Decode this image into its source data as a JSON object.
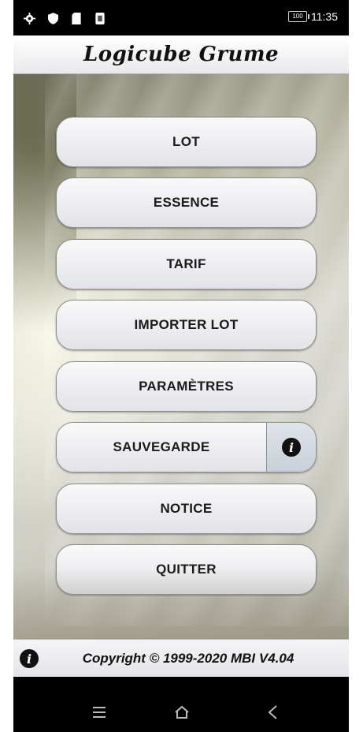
{
  "status_bar": {
    "icons": [
      "gear-icon",
      "shield-icon",
      "sdcard-icon",
      "notification-icon"
    ],
    "battery": "100",
    "time": "11:35"
  },
  "header": {
    "title": "Logicube Grume"
  },
  "menu": {
    "lot": "LOT",
    "essence": "ESSENCE",
    "tarif": "TARIF",
    "importer_lot": "IMPORTER LOT",
    "parametres": "PARAMÈTRES",
    "sauvegarde": "SAUVEGARDE",
    "notice": "NOTICE",
    "quitter": "QUITTER"
  },
  "footer": {
    "copyright": "Copyright © 1999-2020 MBI V4.04"
  },
  "nav_bar": {
    "buttons": [
      "menu-icon",
      "home-icon",
      "back-icon"
    ]
  },
  "colors": {
    "button_face": "#f2f3f5",
    "info_panel": "#d4dae1",
    "text": "#1a1a1a"
  }
}
